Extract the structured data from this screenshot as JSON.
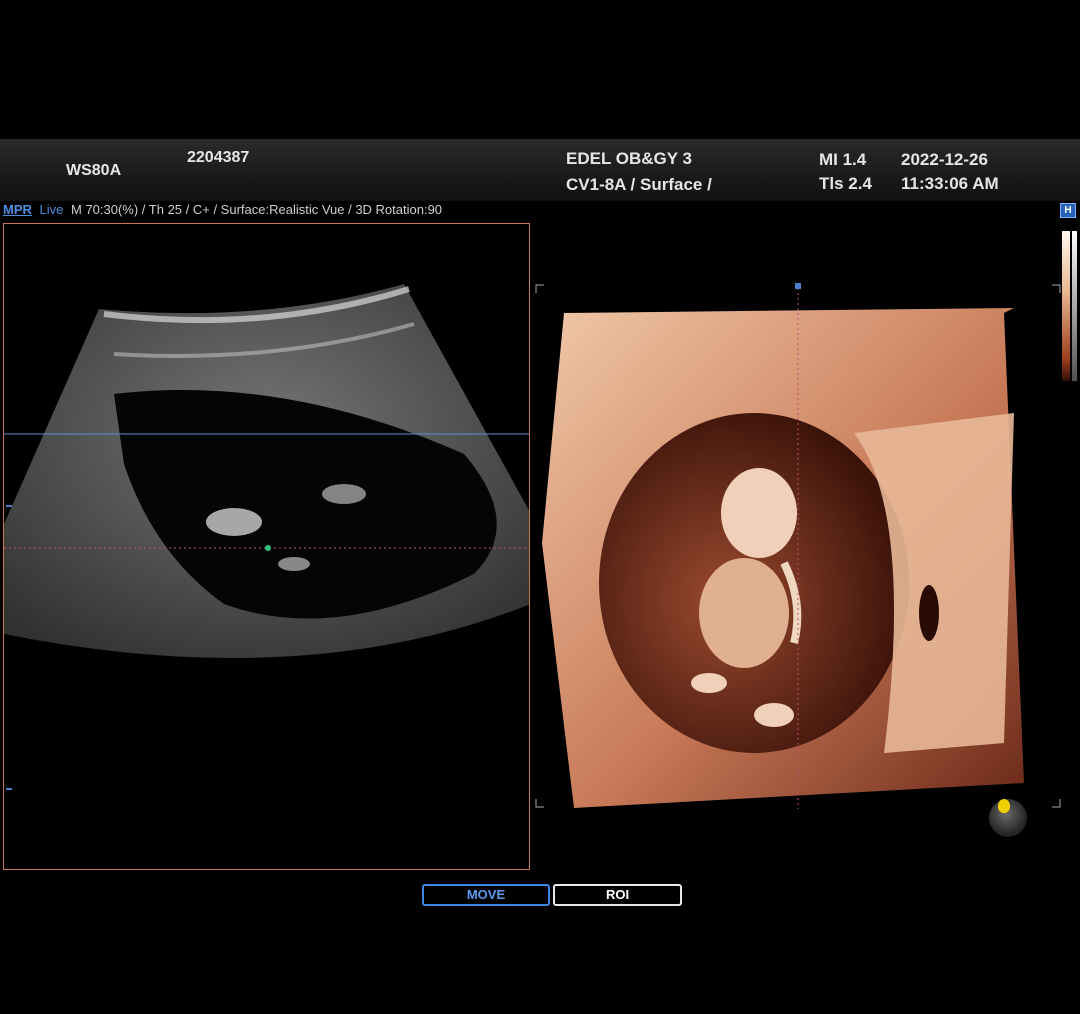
{
  "header": {
    "model": "WS80A",
    "patient_id": "2204387",
    "institution": "EDEL OB&GY 3",
    "probe_mode": "CV1-8A / Surface /",
    "mi": "MI  1.4",
    "tis": "Tls 2.4",
    "date": "2022-12-26",
    "time": "11:33:06 AM"
  },
  "infobar": {
    "mpr": "MPR",
    "live": "Live",
    "params": "M 70:30(%) / Th 25 / C+ / Surface:Realistic Vue / 3D Rotation:90"
  },
  "buttons": {
    "move": "MOVE",
    "roi": "ROI"
  },
  "icons": {
    "help": "H"
  },
  "colors": {
    "accent": "#3f84e0",
    "frame": "#c87850",
    "render_flesh": "#e8b898"
  }
}
